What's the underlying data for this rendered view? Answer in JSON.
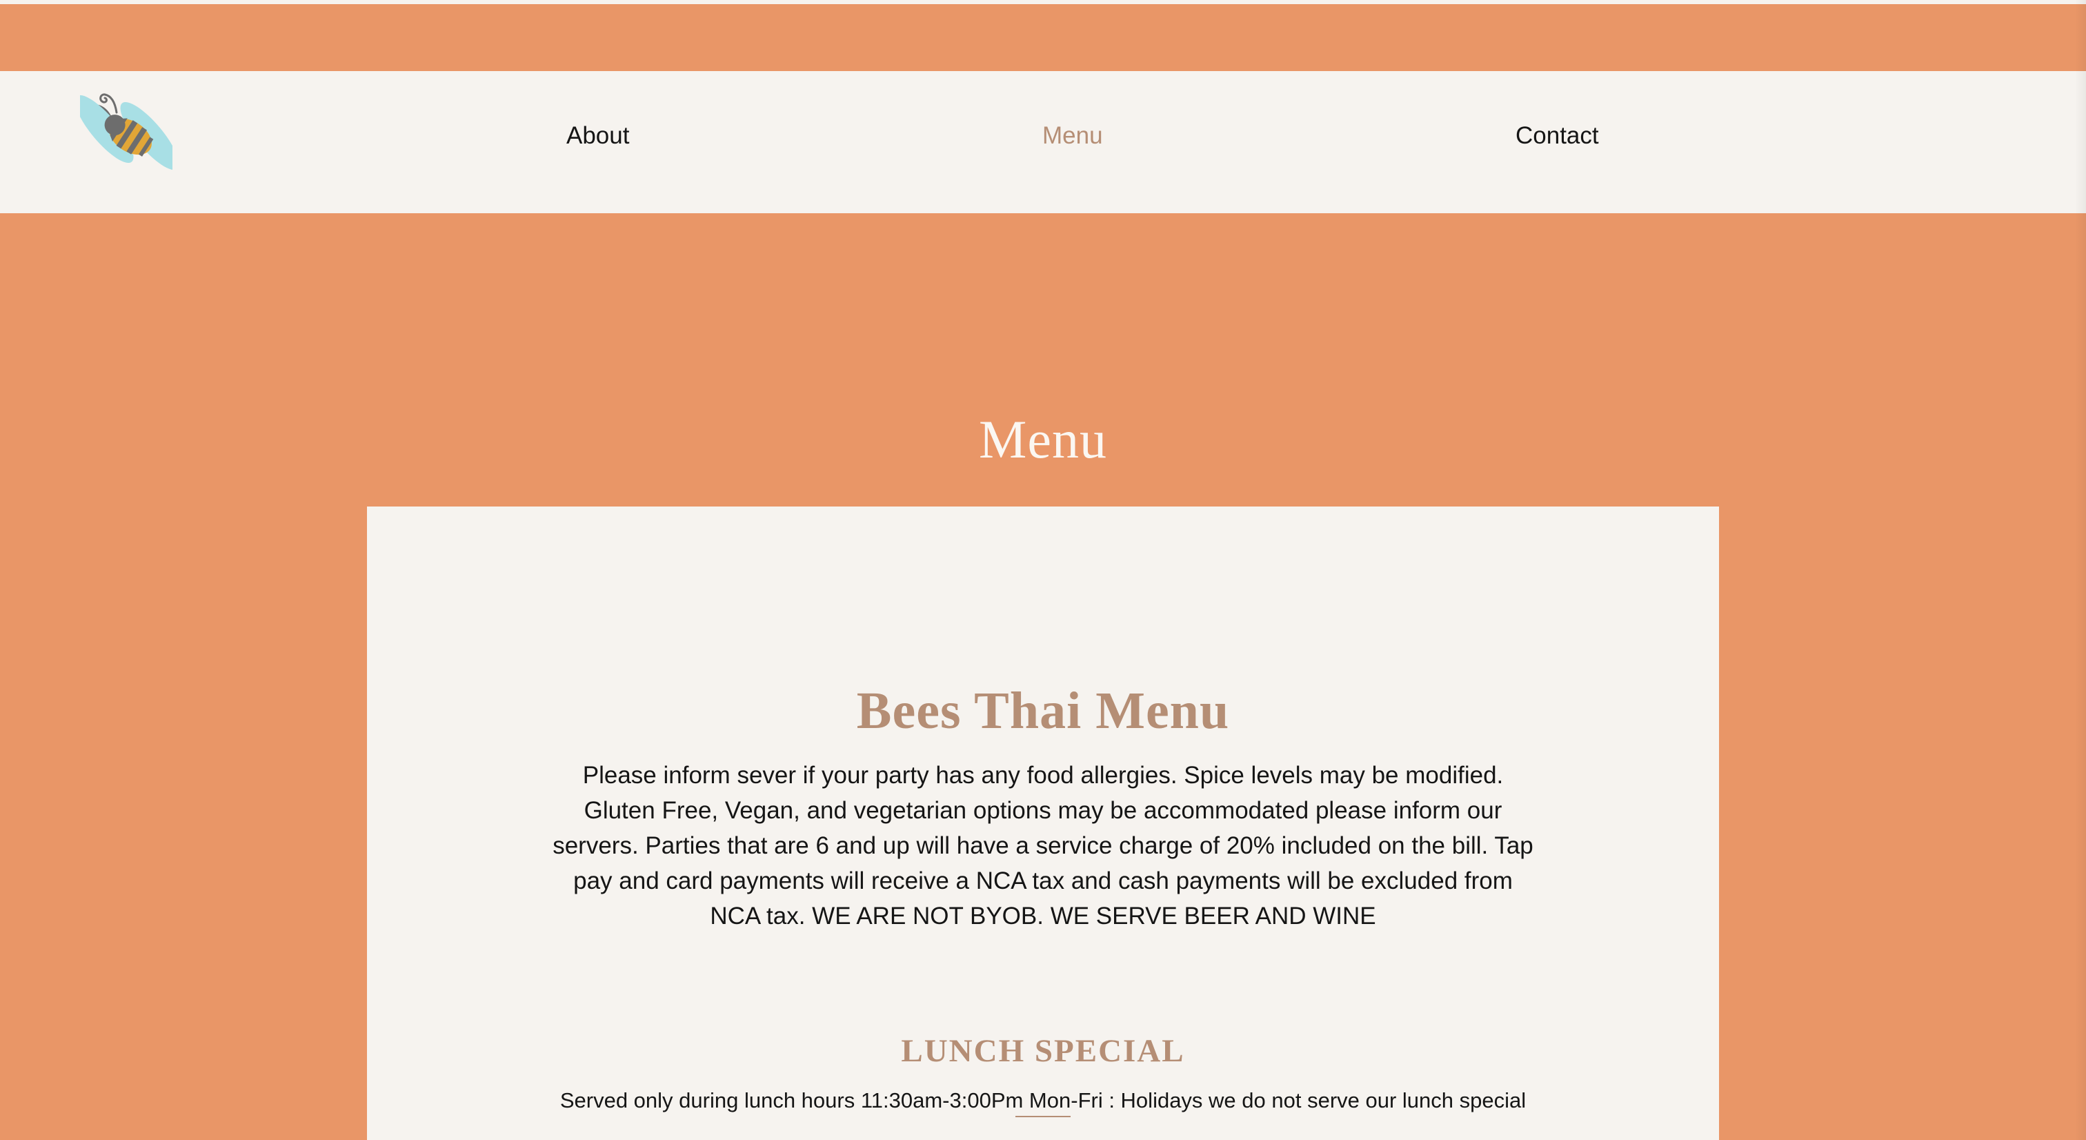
{
  "nav": {
    "logo_icon": "bee-icon",
    "items": [
      {
        "label": "About",
        "active": false
      },
      {
        "label": "Menu",
        "active": true
      },
      {
        "label": "Contact",
        "active": false
      }
    ]
  },
  "hero": {
    "title": "Menu"
  },
  "menu_section": {
    "heading": "Bees Thai Menu",
    "notice": "Please inform sever if your party has any food allergies. Spice levels may be modified. Gluten Free, Vegan, and vegetarian options may be accommodated please inform our servers. Parties that are 6 and up will have a service charge of 20% included on the bill. Tap pay and card payments will receive a NCA tax and cash payments will be excluded from NCA tax. WE ARE NOT BYOB. WE SERVE BEER AND WINE",
    "lunch_special": {
      "heading": "LUNCH SPECIAL",
      "subtext": "Served only during lunch hours 11:30am-3:00Pm Mon-Fri : Holidays we do not serve our lunch special"
    }
  },
  "colors": {
    "background_orange": "#e99667",
    "panel_cream": "#f6f3ef",
    "accent_tan": "#b58e75",
    "text_dark": "#151515",
    "hero_text": "#fbf7f2",
    "bee_wing": "#a8dfe5",
    "bee_body": "#e2a637",
    "bee_stripe": "#6d6d6d"
  }
}
